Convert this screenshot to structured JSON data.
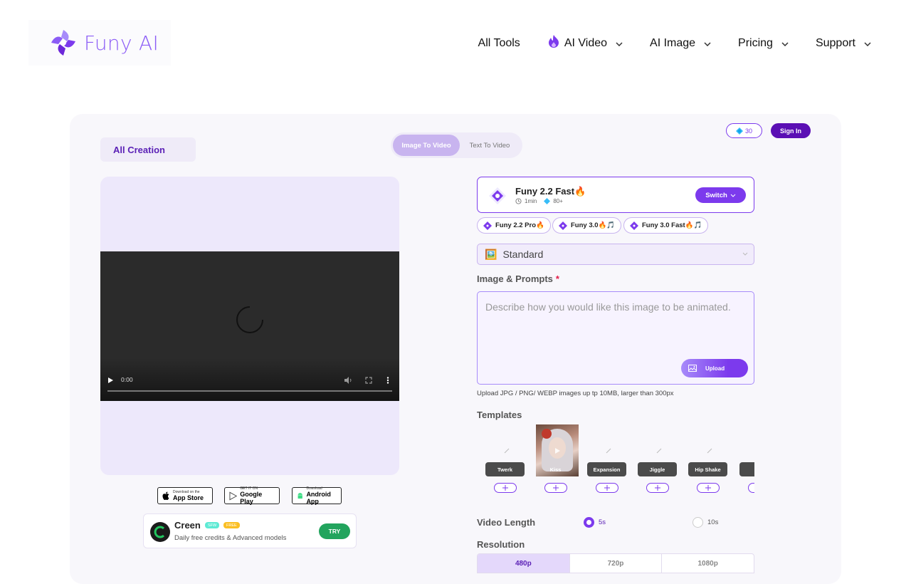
{
  "header": {
    "logo_text": "Funy AI",
    "nav": [
      {
        "label": "All Tools"
      },
      {
        "label": "AI Video"
      },
      {
        "label": "AI Image"
      },
      {
        "label": "Pricing"
      },
      {
        "label": "Support"
      }
    ]
  },
  "toolbar": {
    "all_creation": "All Creation",
    "tabs": [
      "Image To Video",
      "Text To Video"
    ],
    "active_tab": "Image To Video",
    "credits": "30",
    "sign_in": "Sign In"
  },
  "video": {
    "time": "0:00"
  },
  "apps": {
    "appstore_small": "Download on the",
    "appstore_big": "App Store",
    "gplay_small": "GET IT ON",
    "gplay_big": "Google Play",
    "android_small": "Download",
    "android_big": "Android App"
  },
  "promo": {
    "title": "Creen",
    "tag1": "SFW",
    "tag2": "FREE",
    "subtitle": "Daily free credits & Advanced models",
    "cta": "TRY"
  },
  "model": {
    "name": "Funy 2.2 Fast🔥",
    "time": "1min",
    "cost": "80+",
    "switch": "Switch"
  },
  "model_chips": [
    "Funy 2.2 Pro🔥",
    "Funy 3.0🔥🎵",
    "Funy 3.0 Fast🔥🎵"
  ],
  "quality": {
    "emoji": "🖼️",
    "selected": "Standard"
  },
  "prompt": {
    "label": "Image & Prompts",
    "required": "*",
    "placeholder": "Describe how you would like this image to be animated.",
    "upload": "Upload",
    "hint": "Upload JPG / PNG/ WEBP images up tp 10MB, larger than 300px"
  },
  "templates": {
    "label": "Templates",
    "items": [
      "Twerk",
      "Kiss",
      "Expansion",
      "Jiggle",
      "Hip Shake",
      "Re"
    ]
  },
  "video_length": {
    "label": "Video Length",
    "options": [
      "5s",
      "10s"
    ],
    "selected": "5s"
  },
  "resolution": {
    "label": "Resolution",
    "options": [
      "480p",
      "720p",
      "1080p"
    ],
    "selected": "480p"
  },
  "colors": {
    "brand": "#7c3aed",
    "brand_dark": "#5b0fb4",
    "try_green": "#22a45d"
  }
}
